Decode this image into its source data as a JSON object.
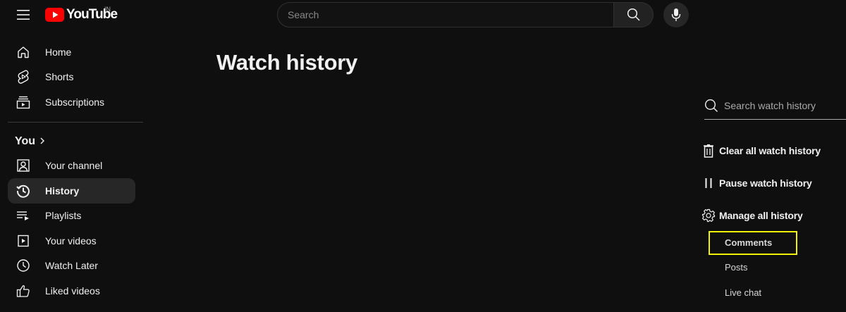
{
  "masthead": {
    "logo_text": "YouTube",
    "country_code": "IN",
    "search_placeholder": "Search"
  },
  "sidebar": {
    "top_items": [
      {
        "label": "Home",
        "icon": "home-icon"
      },
      {
        "label": "Shorts",
        "icon": "shorts-icon"
      },
      {
        "label": "Subscriptions",
        "icon": "subscriptions-icon"
      }
    ],
    "you_section": {
      "heading": "You",
      "items": [
        {
          "label": "Your channel",
          "icon": "your-channel-icon"
        },
        {
          "label": "History",
          "icon": "history-icon",
          "active": true
        },
        {
          "label": "Playlists",
          "icon": "playlists-icon"
        },
        {
          "label": "Your videos",
          "icon": "your-videos-icon"
        },
        {
          "label": "Watch Later",
          "icon": "watch-later-icon"
        },
        {
          "label": "Liked videos",
          "icon": "liked-videos-icon"
        }
      ]
    }
  },
  "main": {
    "title": "Watch history"
  },
  "history_panel": {
    "search_placeholder": "Search watch history",
    "actions": [
      {
        "label": "Clear all watch history",
        "icon": "trash-icon"
      },
      {
        "label": "Pause watch history",
        "icon": "pause-icon"
      },
      {
        "label": "Manage all history",
        "icon": "gear-icon"
      }
    ],
    "manage_items": [
      {
        "label": "Comments",
        "highlighted": true
      },
      {
        "label": "Posts"
      },
      {
        "label": "Live chat"
      }
    ]
  },
  "colors": {
    "background": "#0f0f0f",
    "brand_red": "#ff0000",
    "active_item_bg": "#272727",
    "highlight_outline": "#f0f00a"
  }
}
